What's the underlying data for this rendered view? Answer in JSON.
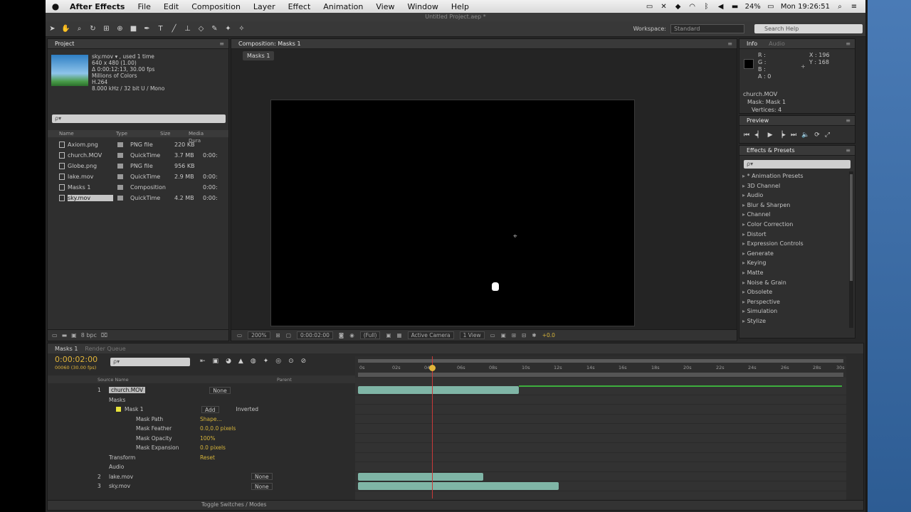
{
  "menubar": {
    "apple": "",
    "app_name": "After Effects",
    "items": [
      "File",
      "Edit",
      "Composition",
      "Layer",
      "Effect",
      "Animation",
      "View",
      "Window",
      "Help"
    ],
    "battery": "24%",
    "clock": "Mon 19:26:51"
  },
  "window": {
    "title": "Untitled Project.aep *"
  },
  "toolbar": {
    "workspace_label": "Workspace:",
    "workspace_value": "Standard",
    "search_placeholder": "Search Help"
  },
  "project": {
    "tab": "Project",
    "selected_name": "sky.mov ▾ , used 1 time",
    "meta": [
      "640 x 480 (1.00)",
      "Δ 0:00:12:13, 30.00 fps",
      "Millions of Colors",
      "H.264",
      "8.000 kHz / 32 bit U / Mono"
    ],
    "search_placeholder": "ρ▾",
    "columns": [
      "Name",
      "Type",
      "Size",
      "Media Dura"
    ],
    "items": [
      {
        "name": "Axiom.png",
        "type": "PNG file",
        "size": "220 KB",
        "dur": ""
      },
      {
        "name": "church.MOV",
        "type": "QuickTime",
        "size": "3.7 MB",
        "dur": "0:00:"
      },
      {
        "name": "Globe.png",
        "type": "PNG file",
        "size": "956 KB",
        "dur": ""
      },
      {
        "name": "lake.mov",
        "type": "QuickTime",
        "size": "2.9 MB",
        "dur": "0:00:"
      },
      {
        "name": "Masks 1",
        "type": "Composition",
        "size": "",
        "dur": "0:00:"
      },
      {
        "name": "sky.mov",
        "type": "QuickTime",
        "size": "4.2 MB",
        "dur": "0:00:"
      }
    ],
    "bpc": "8 bpc"
  },
  "composition": {
    "tab": "Composition: Masks 1",
    "subtab": "Masks 1",
    "zoom": "200%",
    "time": "0:00:02:00",
    "resolution": "(Full)",
    "camera": "Active Camera",
    "view": "1 View",
    "exposure": "+0.0"
  },
  "info": {
    "tab_info": "Info",
    "tab_audio": "Audio",
    "r": "R :",
    "g": "G :",
    "b": "B :",
    "a": "A : 0",
    "x": "X : 196",
    "y": "Y : 168",
    "details": [
      "church.MOV",
      "Mask: Mask 1",
      "Vertices: 4"
    ]
  },
  "preview": {
    "tab": "Preview",
    "controls": [
      "⏮",
      "◂▏",
      "▶",
      "▕▸",
      "⏭",
      "🔈",
      "⟳",
      "⤢"
    ]
  },
  "effects": {
    "tab": "Effects & Presets",
    "search_placeholder": "ρ▾",
    "items": [
      "* Animation Presets",
      "3D Channel",
      "Audio",
      "Blur & Sharpen",
      "Channel",
      "Color Correction",
      "Distort",
      "Expression Controls",
      "Generate",
      "Keying",
      "Matte",
      "Noise & Grain",
      "Obsolete",
      "Perspective",
      "Simulation",
      "Stylize"
    ]
  },
  "timeline": {
    "tab": "Masks 1",
    "tab2": "Render Queue",
    "timecode": "0:00:02:00",
    "fps": "00060 (30.00 fps)",
    "search_placeholder": "ρ▾",
    "col_source": "Source Name",
    "col_parent": "Parent",
    "ruler_ticks": [
      "0s",
      "02s",
      "04s",
      "06s",
      "08s",
      "10s",
      "12s",
      "14s",
      "16s",
      "18s",
      "20s",
      "22s",
      "24s",
      "26s",
      "28s",
      "30s"
    ],
    "layers": [
      {
        "num": "1",
        "name": "church.MOV",
        "parent": "None"
      },
      {
        "num": "2",
        "name": "lake.mov",
        "parent": "None"
      },
      {
        "num": "3",
        "name": "sky.mov",
        "parent": "None"
      }
    ],
    "props": {
      "masks": "Masks",
      "mask1": "Mask 1",
      "mode": "Add",
      "inverted": "Inverted",
      "path_label": "Mask Path",
      "path_value": "Shape...",
      "feather_label": "Mask Feather",
      "feather_value": "0.0,0.0 pixels",
      "opacity_label": "Mask Opacity",
      "opacity_value": "100%",
      "expansion_label": "Mask Expansion",
      "expansion_value": "0.0 pixels",
      "transform": "Transform",
      "transform_value": "Reset",
      "audio": "Audio"
    },
    "toggle": "Toggle Switches / Modes"
  }
}
